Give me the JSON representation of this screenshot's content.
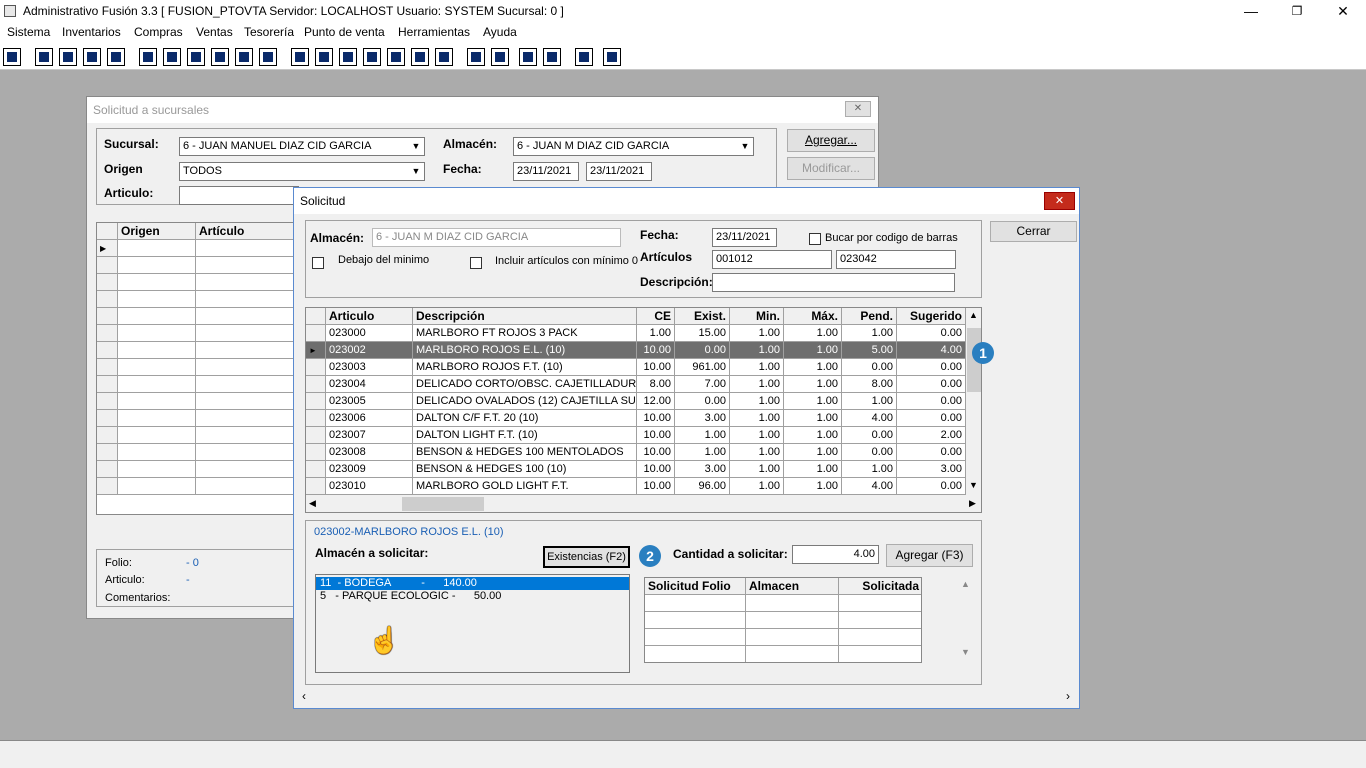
{
  "app": {
    "title": "Administrativo Fusión 3.3 [ FUSION_PTOVTA  Servidor: LOCALHOST  Usuario: SYSTEM    Sucursal: 0 ]",
    "minimize": "—",
    "maximize": "❐",
    "close": "✕"
  },
  "menu": [
    "Sistema",
    "Inventarios",
    "Compras",
    "Ventas",
    "Tesorería",
    "Punto de venta",
    "Herramientas",
    "Ayuda"
  ],
  "toolbar_icons": [
    "calculator-icon",
    "copy-icon",
    "clipboard-icon",
    "exchange-icon",
    "search-doc-icon",
    "user-icon",
    "document-icon",
    "undo-doc-icon",
    "printer-icon",
    "list-icon",
    "grid-icon",
    "users-icon",
    "card-icon",
    "import-icon",
    "add-icon",
    "cash-icon",
    "report-icon",
    "table-icon",
    "home-icon",
    "find-icon",
    "refresh-icon",
    "reload-icon",
    "back-icon",
    "help-icon"
  ],
  "bg_window": {
    "title": "Solicitud a sucursales",
    "close": "✕",
    "sucursal_label": "Sucursal:",
    "sucursal_value": "6 - JUAN MANUEL DIAZ CID GARCIA",
    "origen_label": "Origen",
    "origen_value": "TODOS",
    "articulo_label": "Articulo:",
    "articulo_value": "",
    "almacen_label": "Almacén:",
    "almacen_value": "6 - JUAN M DIAZ CID GARCIA",
    "fecha_label": "Fecha:",
    "fecha_from": "23/11/2021",
    "fecha_to": "23/11/2021",
    "agregar": "Agregar...",
    "modificar": "Modificar...",
    "grid_headers": [
      "Origen",
      "Artículo"
    ],
    "folio_label": "Folio:",
    "folio_value": "- 0",
    "articulo2_label": "Articulo:",
    "articulo2_value": "-",
    "comentarios_label": "Comentarios:"
  },
  "dialog": {
    "title": "Solicitud",
    "close": "✕",
    "cerrar": "Cerrar",
    "almacen_label": "Almacén:",
    "almacen_value": "6    - JUAN M DIAZ CID GARCIA",
    "fecha_label": "Fecha:",
    "fecha_value": "23/11/2021",
    "barcode_label": "Bucar por codigo de barras",
    "debajo_label": "Debajo del minimo",
    "incluir_label": "Incluir artículos con mínimo 0",
    "articulos_label": "Artículos",
    "articulo_from": "001012",
    "articulo_to": "023042",
    "descripcion_label": "Descripción:",
    "descripcion_value": "",
    "table": {
      "headers": [
        "Articulo",
        "Descripción",
        "CE",
        "Exist.",
        "Min.",
        "Máx.",
        "Pend.",
        "Sugerido"
      ],
      "rows": [
        [
          "023000",
          "MARLBORO FT ROJOS 3 PACK",
          "1.00",
          "15.00",
          "1.00",
          "1.00",
          "1.00",
          "0.00"
        ],
        [
          "023002",
          "MARLBORO ROJOS E.L. (10)",
          "10.00",
          "0.00",
          "1.00",
          "1.00",
          "5.00",
          "4.00"
        ],
        [
          "023003",
          "MARLBORO ROJOS F.T. (10)",
          "10.00",
          "961.00",
          "1.00",
          "1.00",
          "0.00",
          "0.00"
        ],
        [
          "023004",
          "DELICADO CORTO/OBSC. CAJETILLADURA",
          "8.00",
          "7.00",
          "1.00",
          "1.00",
          "8.00",
          "0.00"
        ],
        [
          "023005",
          "DELICADO OVALADOS (12) CAJETILLA SUAVI",
          "12.00",
          "0.00",
          "1.00",
          "1.00",
          "1.00",
          "0.00"
        ],
        [
          "023006",
          "DALTON C/F F.T. 20 (10)",
          "10.00",
          "3.00",
          "1.00",
          "1.00",
          "4.00",
          "0.00"
        ],
        [
          "023007",
          "DALTON LIGHT F.T. (10)",
          "10.00",
          "1.00",
          "1.00",
          "1.00",
          "0.00",
          "2.00"
        ],
        [
          "023008",
          "BENSON & HEDGES 100 MENTOLADOS",
          "10.00",
          "1.00",
          "1.00",
          "1.00",
          "0.00",
          "0.00"
        ],
        [
          "023009",
          "BENSON & HEDGES 100 (10)",
          "10.00",
          "3.00",
          "1.00",
          "1.00",
          "1.00",
          "3.00"
        ],
        [
          "023010",
          "MARLBORO GOLD LIGHT F.T.",
          "10.00",
          "96.00",
          "1.00",
          "1.00",
          "4.00",
          "0.00"
        ]
      ]
    },
    "badge1": "1",
    "badge2": "2",
    "selected_item": "023002-MARLBORO ROJOS E.L. (10)",
    "almacen_solicitar_label": "Almacén a solicitar:",
    "existencias_btn": "Existencias (F2)",
    "cantidad_label": "Cantidad a solicitar:",
    "cantidad_value": "4.00",
    "agregar_btn": "Agregar (F3)",
    "almacen_list": [
      "11  - BODEGA          -      140.00",
      "5   - PARQUE ECOLOGIC -      50.00"
    ],
    "sol_headers": [
      "Solicitud Folio",
      "Almacen",
      "Solicitada"
    ]
  }
}
